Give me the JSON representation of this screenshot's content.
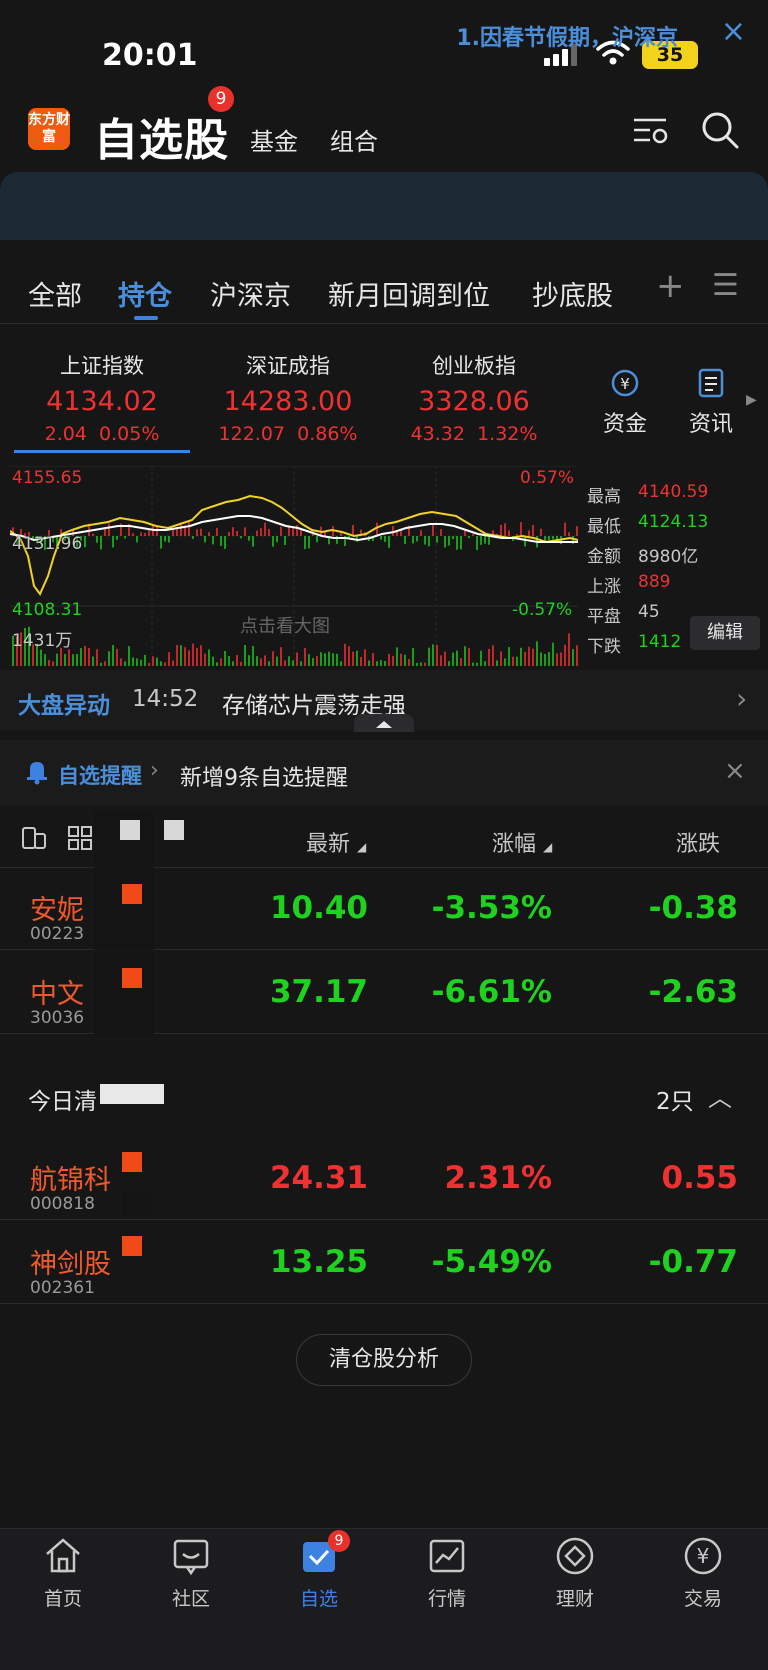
{
  "status_bar": {
    "time": "20:01",
    "battery": "35"
  },
  "header": {
    "logo": "东方财富",
    "title": "自选股",
    "badge": "9",
    "nav": [
      "基金",
      "组合"
    ]
  },
  "notice": {
    "text": "1.因春节假期，沪深京"
  },
  "tabs": [
    "全部",
    "持仓",
    "沪深京",
    "新月回调到位",
    "抄底股"
  ],
  "active_tab": "持仓",
  "indices": [
    {
      "name": "上证指数",
      "value": "4134.02",
      "change": "2.04",
      "pct": "0.05%"
    },
    {
      "name": "深证成指",
      "value": "14283.00",
      "change": "122.07",
      "pct": "0.86%"
    },
    {
      "name": "创业板指",
      "value": "3328.06",
      "change": "43.32",
      "pct": "1.32%"
    }
  ],
  "quick": [
    "资金",
    "资讯"
  ],
  "chart": {
    "high_label": "4155.65",
    "low_label": "4108.31",
    "mid_label": "4131.96",
    "up_pct": "0.57%",
    "down_pct": "-0.57%",
    "volume_label": "1431万",
    "tip": "点击看大图",
    "stats": [
      {
        "label": "最高",
        "value": "4140.59",
        "color": "#f03131"
      },
      {
        "label": "最低",
        "value": "4124.13",
        "color": "#1fd21f"
      },
      {
        "label": "金额",
        "value": "8980亿",
        "color": "#c8c8c8"
      },
      {
        "label": "上涨",
        "value": "889",
        "color": "#f03131"
      },
      {
        "label": "平盘",
        "value": "45",
        "color": "#c8c8c8"
      },
      {
        "label": "下跌",
        "value": "1412",
        "color": "#1fd21f"
      }
    ],
    "edit": "编辑"
  },
  "market_move": {
    "label": "大盘异动",
    "time": "14:52",
    "text": "存储芯片震荡走强"
  },
  "reminder": {
    "label": "自选提醒",
    "text": "新增9条自选提醒"
  },
  "list_header": {
    "latest": "最新",
    "change_pct": "涨幅",
    "change": "涨跌"
  },
  "holdings": [
    {
      "name": "安妮",
      "code": "00223",
      "price": "10.40",
      "pct": "-3.53%",
      "chg": "-0.38",
      "dir": "down"
    },
    {
      "name": "中文",
      "code": "30036",
      "price": "37.17",
      "pct": "-6.61%",
      "chg": "-2.63",
      "dir": "down"
    }
  ],
  "cleared_group": {
    "title": "今日清",
    "count": "2只"
  },
  "cleared": [
    {
      "name": "航锦科",
      "code": "000818",
      "price": "24.31",
      "pct": "2.31%",
      "chg": "0.55",
      "dir": "up"
    },
    {
      "name": "神剑股",
      "code": "002361",
      "price": "13.25",
      "pct": "-5.49%",
      "chg": "-0.77",
      "dir": "down"
    }
  ],
  "analysis_button": "清仓股分析",
  "bottom_nav": [
    "首页",
    "社区",
    "自选",
    "行情",
    "理财",
    "交易"
  ],
  "bottom_badge": "9",
  "colors": {
    "up": "#f03131",
    "down": "#1fd21f",
    "accent": "#3d82e0"
  }
}
